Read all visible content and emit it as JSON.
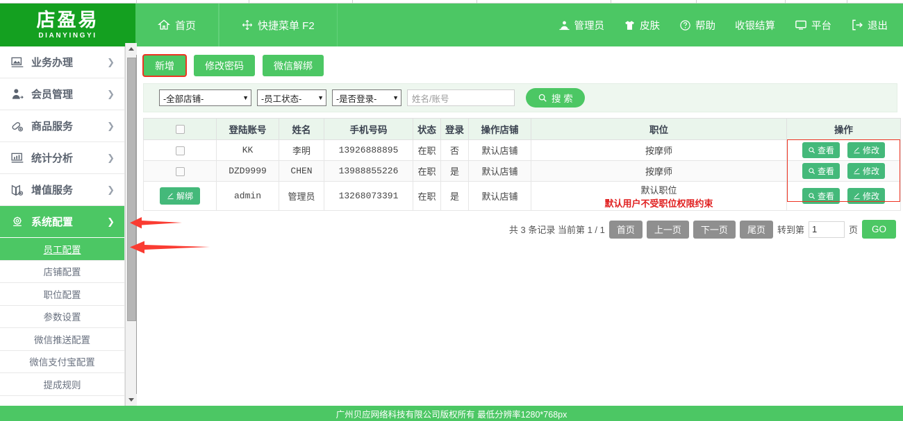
{
  "brand": {
    "name_cn": "店盈易",
    "name_en": "DIANYINGYI"
  },
  "header": {
    "nav_left": [
      {
        "label": "首页",
        "icon": "home-icon"
      },
      {
        "label": "快捷菜单 F2",
        "icon": "move-icon"
      }
    ],
    "nav_right": [
      {
        "label": "管理员",
        "icon": "user-icon"
      },
      {
        "label": "皮肤",
        "icon": "shirt-icon"
      },
      {
        "label": "帮助",
        "icon": "question-circle-icon"
      },
      {
        "label": "收银结算",
        "icon": ""
      },
      {
        "label": "平台",
        "icon": "monitor-icon"
      },
      {
        "label": "退出",
        "icon": "logout-icon"
      }
    ]
  },
  "sidebar": {
    "main_items": [
      {
        "label": "业务办理",
        "icon": "image-icon",
        "active": false
      },
      {
        "label": "会员管理",
        "icon": "member-icon",
        "active": false
      },
      {
        "label": "商品服务",
        "icon": "pill-icon",
        "active": false
      },
      {
        "label": "统计分析",
        "icon": "chart-monitor-icon",
        "active": false
      },
      {
        "label": "增值服务",
        "icon": "book-plus-icon",
        "active": false
      },
      {
        "label": "系统配置",
        "icon": "gear-icon",
        "active": true
      }
    ],
    "sub_items": [
      {
        "label": "员工配置",
        "active": true
      },
      {
        "label": "店铺配置",
        "active": false
      },
      {
        "label": "职位配置",
        "active": false
      },
      {
        "label": "参数设置",
        "active": false
      },
      {
        "label": "微信推送配置",
        "active": false
      },
      {
        "label": "微信支付宝配置",
        "active": false
      },
      {
        "label": "提成规则",
        "active": false
      }
    ]
  },
  "toolbar": {
    "add_label": "新增",
    "change_password_label": "修改密码",
    "wechat_unbind_label": "微信解绑"
  },
  "filters": {
    "shop": "-全部店铺-",
    "status": "-员工状态-",
    "login": "-是否登录-",
    "keyword_value": "",
    "keyword_placeholder": "姓名/账号",
    "search_label": "搜 索",
    "search_icon": "search-icon"
  },
  "table": {
    "columns": [
      "",
      "登陆账号",
      "姓名",
      "手机号码",
      "状态",
      "登录",
      "操作店铺",
      "职位",
      "操作"
    ],
    "rows": [
      {
        "select": "checkbox",
        "account": "KK",
        "name": "李明",
        "phone": "13926888895",
        "status": "在职",
        "login": "否",
        "shop": "默认店铺",
        "position": "按摩师",
        "position_note": "",
        "view_label": "查看",
        "edit_label": "修改"
      },
      {
        "select": "checkbox",
        "account": "DZD9999",
        "name": "CHEN",
        "phone": "13988855226",
        "status": "在职",
        "login": "是",
        "shop": "默认店铺",
        "position": "按摩师",
        "position_note": "",
        "view_label": "查看",
        "edit_label": "修改"
      },
      {
        "select": "button",
        "select_label": "解绑",
        "account": "admin",
        "name": "管理员",
        "phone": "13268073391",
        "status": "在职",
        "login": "是",
        "shop": "默认店铺",
        "position": "默认职位",
        "position_note": "默认用户不受职位权限约束",
        "view_label": "查看",
        "edit_label": "修改"
      }
    ]
  },
  "pager": {
    "summary": "共 3 条记录 当前第 1 / 1",
    "first": "首页",
    "prev": "上一页",
    "next": "下一页",
    "last": "尾页",
    "goto_prefix": "转到第",
    "page_value": "1",
    "goto_suffix": "页",
    "go": "GO"
  },
  "footer": {
    "text": "广州贝应网络科技有限公司版权所有 最低分辨率1280*768px"
  },
  "colors": {
    "brand_dark_green": "#14a020",
    "brand_green": "#4cc764",
    "table_header": "#eaf5ec",
    "filter_bar": "#eef7ef",
    "annotation_red": "#ee3322",
    "note_red": "#e02020",
    "pager_grey": "#8f8f8f"
  }
}
